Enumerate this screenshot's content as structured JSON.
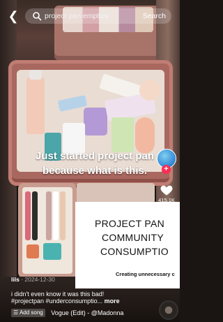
{
  "search": {
    "back_icon": "back-arrow-icon",
    "query": "project pan empties",
    "submit_label": "Search"
  },
  "video": {
    "overlay_caption": "Just started project pan because what is this.",
    "inset_card": {
      "title_lines": [
        "PROJECT PAN",
        "COMMUNITY",
        "CONSUMPTIO"
      ],
      "subtitle": "Creating unnecessary c"
    }
  },
  "side_actions": {
    "avatar_icon": "creator-avatar-icon",
    "follow_icon": "plus-icon",
    "like_icon": "heart-icon",
    "like_count": "415.1K"
  },
  "post": {
    "username": "lils",
    "date": "2024-12-30",
    "description": "i didn't even know it was this bad!",
    "hashtags": "#projectpan #underconsumptio...",
    "more_label": "more"
  },
  "music": {
    "add_song_label": "Add song",
    "song_title": "Vogue (Edit) - @Madonna",
    "disc_icon": "music-disc-icon"
  },
  "colors": {
    "follow_red": "#fe2c55",
    "bin_pink": "#a8685f"
  }
}
